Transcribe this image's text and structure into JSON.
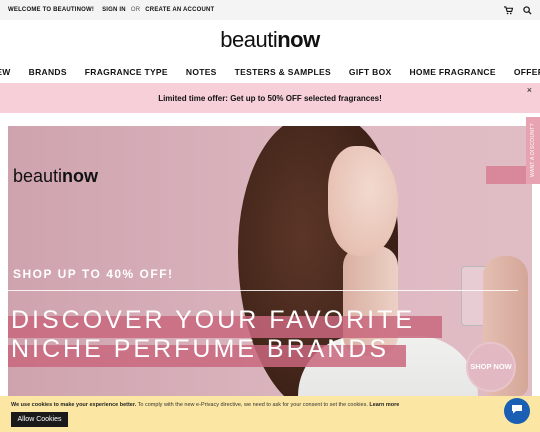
{
  "topbar": {
    "welcome": "WELCOME TO BEAUTINOW!",
    "sign_in": "SIGN IN",
    "or": "OR",
    "create_account": "CREATE AN ACCOUNT",
    "icons": [
      "cart-icon",
      "search-icon"
    ]
  },
  "logo": {
    "part1": "beauti",
    "part2": "now"
  },
  "nav": {
    "items": [
      "NEW",
      "BRANDS",
      "FRAGRANCE TYPE",
      "NOTES",
      "TESTERS & SAMPLES",
      "GIFT BOX",
      "HOME FRAGRANCE",
      "OFFERS"
    ]
  },
  "promo": {
    "text": "Limited time offer: Get up to 50% OFF selected fragrances!",
    "close": "×"
  },
  "hero": {
    "logo_part1": "beauti",
    "logo_part2": "now",
    "shop_upto": "SHOP UP TO 40% OFF!",
    "title_line1": "DISCOVER YOUR FAVORITE",
    "title_line2": "NICHE PERFUME BRANDS",
    "shop_now": "SHOP NOW"
  },
  "side_tab": {
    "label": "WANT A DISCOUNT?"
  },
  "cookie": {
    "bold": "We use cookies to make your experience better.",
    "text": " To comply with the new e-Privacy directive, we need to ask for your consent to set the cookies. ",
    "learn_more": "Learn more",
    "allow": "Allow Cookies"
  },
  "colors": {
    "promo_bg": "#f6cfd8",
    "hero_accent": "#c9677e",
    "cookie_bg": "#fbe7a3",
    "chat_bg": "#1a5fb4"
  }
}
